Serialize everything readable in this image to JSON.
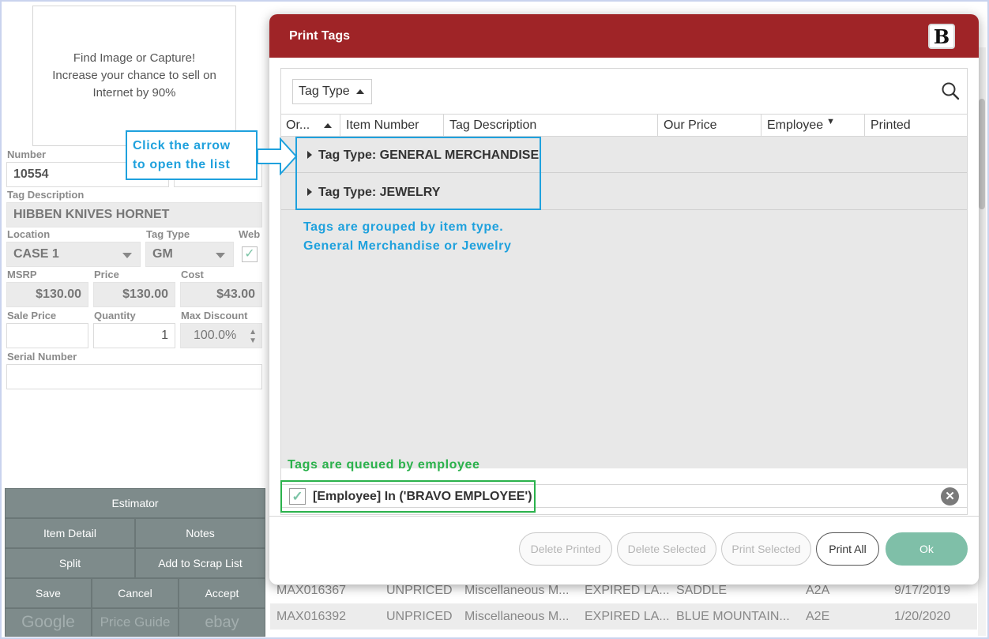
{
  "item_form": {
    "image_prompt": [
      "Find Image or Capture!",
      "Increase your chance to sell on",
      "Internet by 90%"
    ],
    "number_label": "Number",
    "number_value": "10554",
    "tag_description_label": "Tag Description",
    "tag_description_value": "HIBBEN KNIVES HORNET",
    "location_label": "Location",
    "location_value": "CASE 1",
    "tag_type_label": "Tag Type",
    "tag_type_value": "GM",
    "web_label": "Web",
    "web_checked": true,
    "msrp_label": "MSRP",
    "msrp_value": "$130.00",
    "price_label": "Price",
    "price_value": "$130.00",
    "cost_label": "Cost",
    "cost_value": "$43.00",
    "sale_price_label": "Sale Price",
    "sale_price_value": "",
    "quantity_label": "Quantity",
    "quantity_value": "1",
    "max_discount_label": "Max Discount",
    "max_discount_value": "100.0%",
    "serial_number_label": "Serial Number",
    "serial_number_value": ""
  },
  "action_buttons": {
    "estimator": "Estimator",
    "item_detail": "Item Detail",
    "notes": "Notes",
    "split": "Split",
    "add_to_scrap": "Add to Scrap List",
    "save": "Save",
    "cancel": "Cancel",
    "accept": "Accept",
    "google": "Google",
    "price_guide": "Price Guide",
    "ebay": "ebay"
  },
  "background_rows": [
    {
      "id": "MAX016367",
      "status": "UNPRICED",
      "category": "Miscellaneous M...",
      "state": "EXPIRED LA...",
      "desc": "SADDLE",
      "loc": "A2A",
      "date": "9/17/2019"
    },
    {
      "id": "MAX016392",
      "status": "UNPRICED",
      "category": "Miscellaneous M...",
      "state": "EXPIRED LA...",
      "desc": "BLUE MOUNTAIN...",
      "loc": "A2E",
      "date": "1/20/2020"
    }
  ],
  "dialog": {
    "title": "Print Tags",
    "logo_letter": "B",
    "group_by_label": "Tag Type",
    "columns": [
      "Or...",
      "Item Number",
      "Tag Description",
      "Our Price",
      "Employee",
      "Printed"
    ],
    "groups": [
      {
        "label": "Tag Type: GENERAL MERCHANDISE"
      },
      {
        "label": "Tag Type: JEWELRY"
      }
    ],
    "filter_text": "[Employee] In ('BRAVO EMPLOYEE')",
    "filter_checked": true,
    "buttons": {
      "delete_printed": "Delete Printed",
      "delete_selected": "Delete Selected",
      "print_selected": "Print Selected",
      "print_all": "Print All",
      "ok": "Ok"
    }
  },
  "annotations": {
    "callout_line1": "Click the arrow",
    "callout_line2": "to open the list",
    "grouped_line1": "Tags are grouped by item type.",
    "grouped_line2": "General Merchandise or Jewelry",
    "queued": "Tags are queued by employee"
  },
  "colors": {
    "dialog_header": "#9f2427",
    "annotation_blue": "#1fa1dd",
    "annotation_green": "#2bb24c",
    "ok_button": "#7fbfa8",
    "button_grid": "#7e8b8b"
  }
}
